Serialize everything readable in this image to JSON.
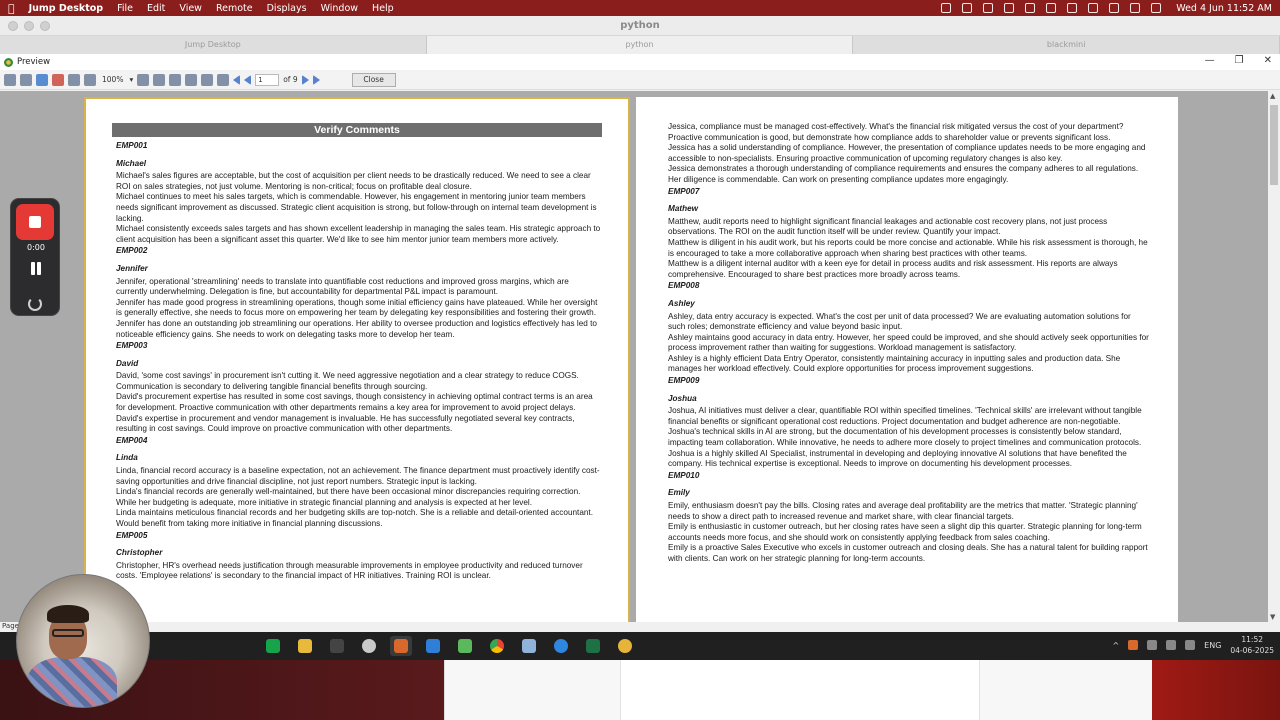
{
  "menubar": {
    "app_name": "Jump Desktop",
    "menus": [
      "File",
      "Edit",
      "View",
      "Remote",
      "Displays",
      "Window",
      "Help"
    ],
    "datetime": "Wed 4 Jun  11:52 AM"
  },
  "jump_window": {
    "title": "python",
    "tabs": [
      "Jump Desktop",
      "python",
      "blackmini"
    ]
  },
  "preview": {
    "title": "Preview",
    "zoom": "100%",
    "page_current": "1",
    "page_total": "of 9",
    "close_label": "Close",
    "status": "Page"
  },
  "left_page": {
    "title": "Verify Comments",
    "blocks": [
      {
        "emp": "EMP001",
        "name": "Michael",
        "comments": [
          "Michael's sales figures are acceptable, but the cost of acquisition per client needs to be drastically reduced. We need to see a clear ROI on sales strategies, not just volume. Mentoring is non-critical; focus on profitable deal closure.",
          "Michael continues to meet his sales targets, which is commendable. However, his engagement in mentoring junior team members needs significant improvement as discussed. Strategic client acquisition is strong, but follow-through on internal team development is lacking.",
          "Michael consistently exceeds sales targets and has shown excellent leadership in managing the sales team. His strategic approach to client acquisition has been a significant asset this quarter. We'd like to see him mentor junior team members more actively."
        ]
      },
      {
        "emp": "EMP002",
        "name": "Jennifer",
        "comments": [
          "Jennifer, operational 'streamlining' needs to translate into quantifiable cost reductions and improved gross margins, which are currently underwhelming. Delegation is fine, but accountability for departmental P&L impact is paramount.",
          "Jennifer has made good progress in streamlining operations, though some initial efficiency gains have plateaued. While her oversight is generally effective, she needs to focus more on empowering her team by delegating key responsibilities and fostering their growth.",
          "Jennifer has done an outstanding job streamlining our operations. Her ability to oversee production and logistics effectively has led to noticeable efficiency gains. She needs to work on delegating tasks more to develop her team."
        ]
      },
      {
        "emp": "EMP003",
        "name": "David",
        "comments": [
          "David, 'some cost savings' in procurement isn't cutting it. We need aggressive negotiation and a clear strategy to reduce COGS. Communication is secondary to delivering tangible financial benefits through sourcing.",
          "David's procurement expertise has resulted in some cost savings, though consistency in achieving optimal contract terms is an area for development. Proactive communication with other departments remains a key area for improvement to avoid project delays.",
          "David's expertise in procurement and vendor management is invaluable. He has successfully negotiated several key contracts, resulting in cost savings. Could improve on proactive communication with other departments."
        ]
      },
      {
        "emp": "EMP004",
        "name": "Linda",
        "comments": [
          "Linda, financial record accuracy is a baseline expectation, not an achievement. The finance department must proactively identify cost-saving opportunities and drive financial discipline, not just report numbers. Strategic input is lacking.",
          "Linda's financial records are generally well-maintained, but there have been occasional minor discrepancies requiring correction. While her budgeting is adequate, more initiative in strategic financial planning and analysis is expected at her level.",
          "Linda maintains meticulous financial records and her budgeting skills are top-notch. She is a reliable and detail-oriented accountant. Would benefit from taking more initiative in financial planning discussions."
        ]
      },
      {
        "emp": "EMP005",
        "name": "Christopher",
        "comments": [
          "Christopher, HR's overhead needs justification through measurable improvements in employee productivity and reduced turnover costs. 'Employee relations' is secondary to the financial impact of HR initiatives. Training ROI is unclear."
        ]
      }
    ]
  },
  "right_page": {
    "blocks": [
      {
        "emp": "",
        "name": "",
        "comments": [
          "Jessica, compliance must be managed cost-effectively. What's the financial risk mitigated versus the cost of your department? Proactive communication is good, but demonstrate how compliance adds to shareholder value or prevents significant loss.",
          "Jessica has a solid understanding of compliance. However, the presentation of compliance updates needs to be more engaging and accessible to non-specialists. Ensuring proactive communication of upcoming regulatory changes is also key.",
          "Jessica demonstrates a thorough understanding of compliance requirements and ensures the company adheres to all regulations. Her diligence is commendable. Can work on presenting compliance updates more engagingly."
        ]
      },
      {
        "emp": "EMP007",
        "name": "Mathew",
        "comments": [
          "Matthew, audit reports need to highlight significant financial leakages and actionable cost recovery plans, not just process observations. The ROI on the audit function itself will be under review. Quantify your impact.",
          "Matthew is diligent in his audit work, but his reports could be more concise and actionable. While his risk assessment is thorough, he is encouraged to take a more collaborative approach when sharing best practices with other teams.",
          "Matthew is a diligent internal auditor with a keen eye for detail in process audits and risk assessment. His reports are always comprehensive. Encouraged to share best practices more broadly across teams."
        ]
      },
      {
        "emp": "EMP008",
        "name": "Ashley",
        "comments": [
          "Ashley, data entry accuracy is expected. What's the cost per unit of data processed? We are evaluating automation solutions for such roles; demonstrate efficiency and value beyond basic input.",
          "Ashley maintains good accuracy in data entry. However, her speed could be improved, and she should actively seek opportunities for process improvement rather than waiting for suggestions. Workload management is satisfactory.",
          "Ashley is a highly efficient Data Entry Operator, consistently maintaining accuracy in inputting sales and production data. She manages her workload effectively. Could explore opportunities for process improvement suggestions."
        ]
      },
      {
        "emp": "EMP009",
        "name": "Joshua",
        "comments": [
          "Joshua, AI initiatives must deliver a clear, quantifiable ROI within specified timelines. 'Technical skills' are irrelevant without tangible financial benefits or significant operational cost reductions. Project documentation and budget adherence are non-negotiable.",
          "Joshua's technical skills in AI are strong, but the documentation of his development processes is consistently below standard, impacting team collaboration. While innovative, he needs to adhere more closely to project timelines and communication protocols.",
          "Joshua is a highly skilled AI Specialist, instrumental in developing and deploying innovative AI solutions that have benefited the company. His technical expertise is exceptional. Needs to improve on documenting his development processes."
        ]
      },
      {
        "emp": "EMP010",
        "name": "Emily",
        "comments": [
          "Emily, enthusiasm doesn't pay the bills. Closing rates and average deal profitability are the metrics that matter. 'Strategic planning' needs to show a direct path to increased revenue and market share, with clear financial targets.",
          "Emily is enthusiastic in customer outreach, but her closing rates have seen a slight dip this quarter. Strategic planning for long-term accounts needs more focus, and she should work on consistently applying feedback from sales coaching.",
          "Emily is a proactive Sales Executive who excels in customer outreach and closing deals. She has a natural talent for building rapport with clients. Can work on her strategic planning for long-term accounts."
        ]
      }
    ]
  },
  "taskbar": {
    "lang": "ENG",
    "time": "11:52",
    "date": "04-06-2025"
  },
  "recorder": {
    "elapsed": "0:00"
  },
  "colors": {
    "menubar": "#8a1e1c",
    "title_bar": "#6e6e6e",
    "page_border": "#d9b24a",
    "record": "#e53935"
  }
}
